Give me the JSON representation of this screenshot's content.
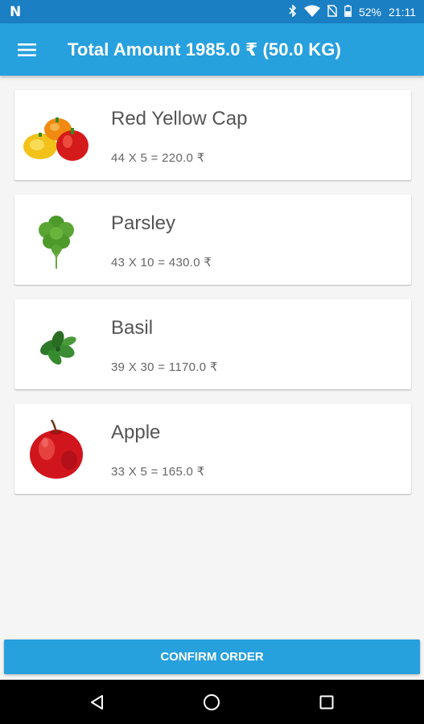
{
  "status_bar": {
    "battery_percent": "52%",
    "time": "21:11",
    "icons": [
      "n-notification-icon",
      "bluetooth-icon",
      "wifi-icon",
      "no-sim-icon",
      "battery-icon"
    ]
  },
  "app_bar": {
    "menu_icon": "hamburger-menu-icon",
    "title": "Total Amount 1985.0 ₹ (50.0 KG)"
  },
  "items": [
    {
      "name": "Red Yellow Cap",
      "calc": "44 X 5 = 220.0 ₹",
      "image": "bell-peppers"
    },
    {
      "name": "Parsley",
      "calc": "43 X 10 = 430.0 ₹",
      "image": "parsley"
    },
    {
      "name": "Basil",
      "calc": "39 X 30 = 1170.0 ₹",
      "image": "basil"
    },
    {
      "name": "Apple",
      "calc": "33 X 5 = 165.0 ₹",
      "image": "apple"
    }
  ],
  "confirm_button": {
    "label": "CONFIRM ORDER"
  },
  "nav_bar": {
    "icons": [
      "back-icon",
      "home-icon",
      "recents-icon"
    ]
  },
  "colors": {
    "status_bar": "#1b7fc4",
    "app_bar": "#27a0de",
    "accent": "#27a0de",
    "background": "#f5f5f5"
  }
}
